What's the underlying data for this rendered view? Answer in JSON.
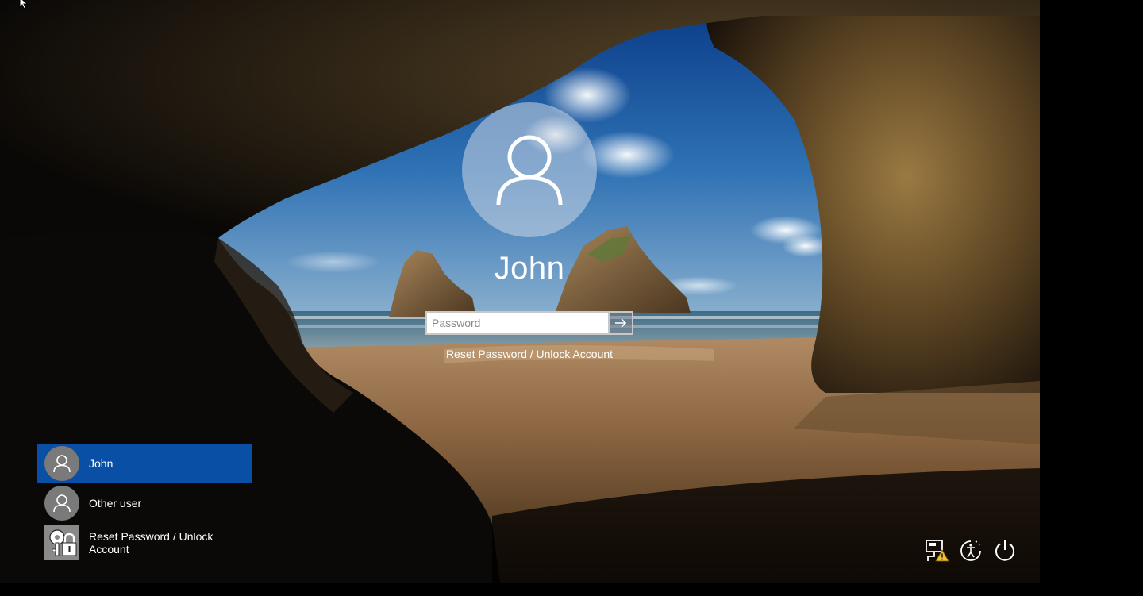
{
  "login": {
    "user_name": "John",
    "password_placeholder": "Password",
    "reset_link": "Reset Password / Unlock Account"
  },
  "user_list": [
    {
      "label": "John",
      "selected": true,
      "icon": "user-avatar-icon"
    },
    {
      "label": "Other user",
      "selected": false,
      "icon": "user-avatar-icon"
    },
    {
      "label": "Reset Password / Unlock Account",
      "selected": false,
      "icon": "lock-reset-icon"
    }
  ],
  "system_icons": [
    "network-warning-icon",
    "ease-of-access-icon",
    "power-icon"
  ],
  "colors": {
    "selected_user_bg": "#0a4fa6",
    "text": "#ffffff",
    "warning": "#f2c230"
  }
}
